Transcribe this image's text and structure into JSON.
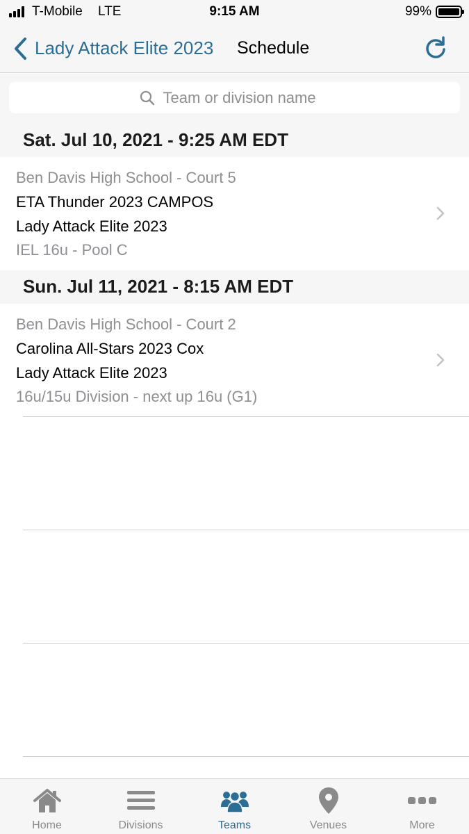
{
  "status_bar": {
    "carrier": "T-Mobile",
    "network": "LTE",
    "time": "9:15 AM",
    "battery": "99%",
    "battery_level": 0.99
  },
  "nav": {
    "back_label": "Lady Attack Elite 2023",
    "title": "Schedule"
  },
  "search": {
    "placeholder": "Team or division name",
    "value": ""
  },
  "schedule": [
    {
      "date": "Sat. Jul 10, 2021 - 9:25 AM EDT",
      "venue": "Ben Davis High School - Court 5",
      "team1": "ETA Thunder 2023 CAMPOS",
      "team2": "Lady Attack Elite 2023",
      "division": "IEL 16u - Pool C"
    },
    {
      "date": "Sun. Jul 11, 2021 - 8:15 AM EDT",
      "venue": "Ben Davis High School - Court 2",
      "team1": "Carolina All-Stars 2023 Cox",
      "team2": "Lady Attack Elite 2023",
      "division": "16u/15u Division - next up 16u (G1)"
    }
  ],
  "tabs": [
    {
      "label": "Home",
      "icon": "home-icon",
      "active": false
    },
    {
      "label": "Divisions",
      "icon": "list-icon",
      "active": false
    },
    {
      "label": "Teams",
      "icon": "people-icon",
      "active": true
    },
    {
      "label": "Venues",
      "icon": "location-pin-icon",
      "active": false
    },
    {
      "label": "More",
      "icon": "more-dots-icon",
      "active": false
    }
  ],
  "colors": {
    "accent": "#2b6d94",
    "inactive": "#8a8a8a",
    "secondary_text": "#8e8e93",
    "bar_background": "#f6f6f6"
  }
}
